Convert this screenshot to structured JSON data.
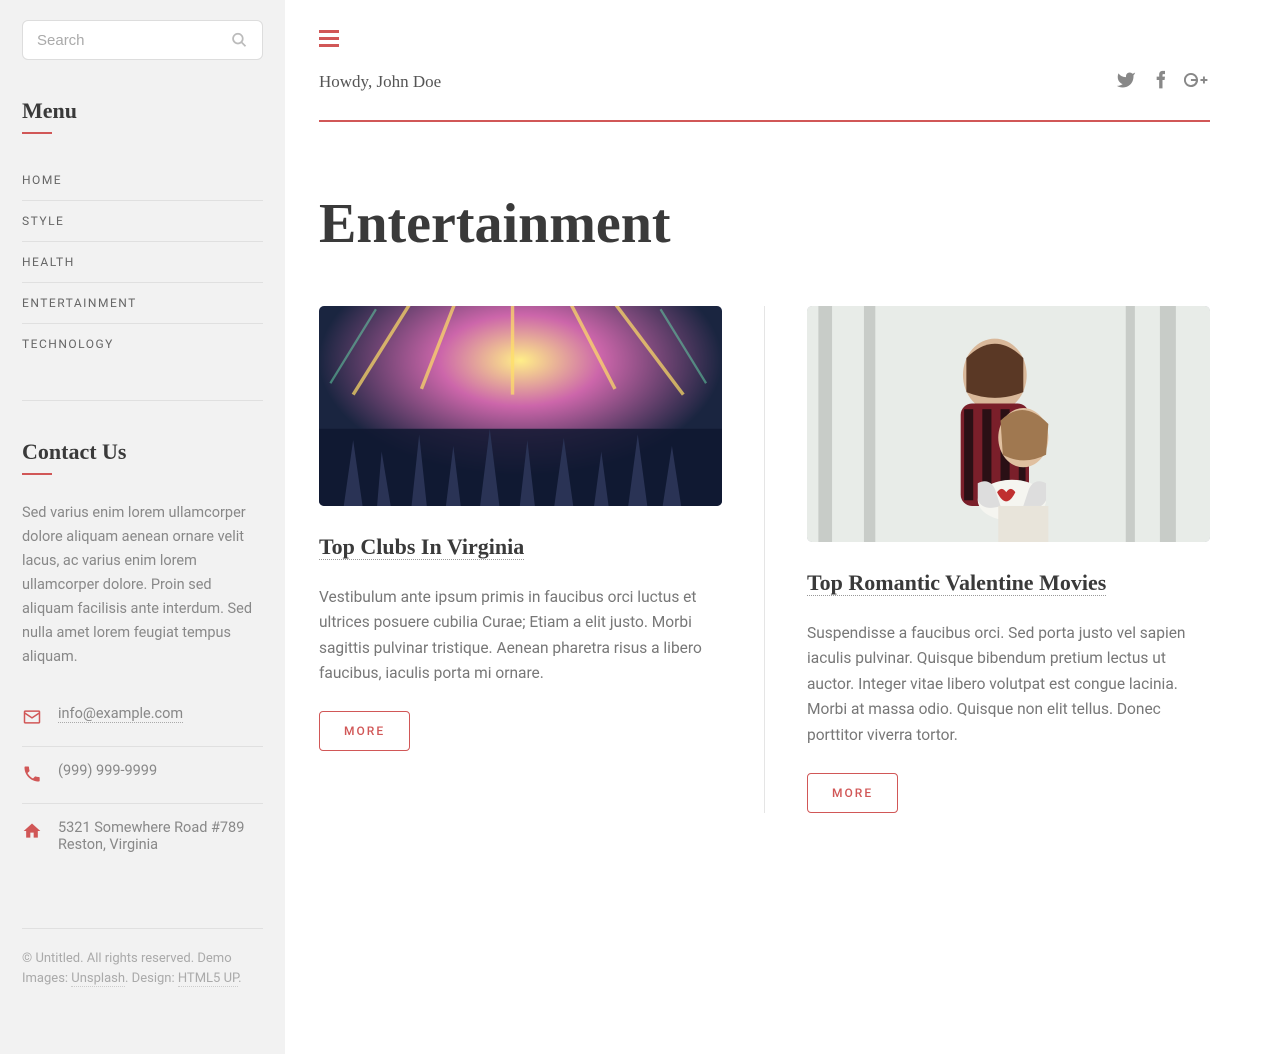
{
  "sidebar": {
    "search_placeholder": "Search",
    "menu_heading": "Menu",
    "menu_items": [
      "HOME",
      "STYLE",
      "HEALTH",
      "ENTERTAINMENT",
      "TECHNOLOGY"
    ],
    "contact_heading": "Contact Us",
    "contact_text": "Sed varius enim lorem ullamcorper dolore aliquam aenean ornare velit lacus, ac varius enim lorem ullamcorper dolore. Proin sed aliquam facilisis ante interdum. Sed nulla amet lorem feugiat tempus aliquam.",
    "contact_email": "info@example.com",
    "contact_phone": "(999) 999-9999",
    "contact_address": "5321 Somewhere Road #789 Reston, Virginia",
    "footer_prefix": "© Untitled. All rights reserved. Demo Images: ",
    "footer_link1": "Unsplash",
    "footer_mid": ". Design: ",
    "footer_link2": "HTML5 UP",
    "footer_suffix": "."
  },
  "header": {
    "greeting": "Howdy, John Doe"
  },
  "page": {
    "title": "Entertainment"
  },
  "posts": [
    {
      "title": "Top Clubs In Virginia",
      "excerpt": "Vestibulum ante ipsum primis in faucibus orci luctus et ultrices posuere cubilia Curae; Etiam a elit justo. Morbi sagittis pulvinar tristique. Aenean pharetra risus a libero faucibus, iaculis porta mi ornare.",
      "more": "MORE"
    },
    {
      "title": "Top Romantic Valentine Movies",
      "excerpt": "Suspendisse a faucibus orci. Sed porta justo vel sapien iaculis pulvinar. Quisque bibendum pretium lectus ut auctor. Integer vitae libero volutpat est congue lacinia. Morbi at massa odio. Quisque non elit tellus. Donec porttitor viverra tortor.",
      "more": "MORE"
    }
  ]
}
